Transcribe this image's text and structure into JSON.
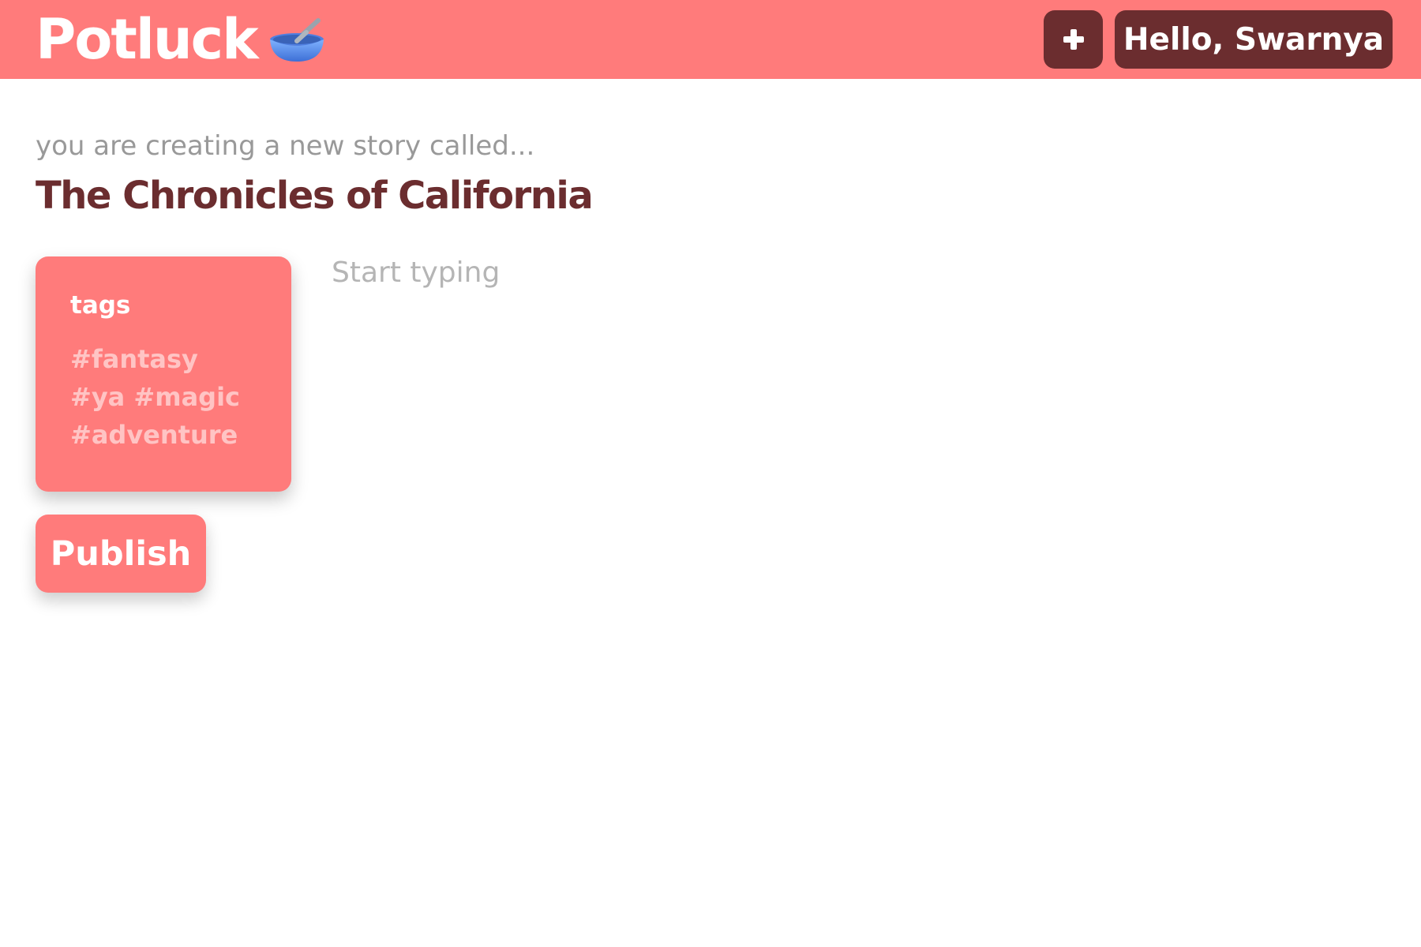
{
  "header": {
    "app_name": "Potluck",
    "logo_icon": "bowl-with-spoon-icon",
    "add_button_icon": "plus-icon",
    "greeting": "Hello, Swarnya"
  },
  "story": {
    "prompt": "you are creating a new story called...",
    "title": "The Chronicles of California"
  },
  "tags": {
    "heading": "tags",
    "value": "#fantasy #ya #magic #adventure"
  },
  "editor": {
    "placeholder": "Start typing"
  },
  "actions": {
    "publish_label": "Publish"
  },
  "colors": {
    "brand": "#ff7b7b",
    "dark": "#6b2d2f",
    "muted_text": "#999999",
    "placeholder_text": "#b5b5b5",
    "tag_text": "#ffc4c4"
  }
}
